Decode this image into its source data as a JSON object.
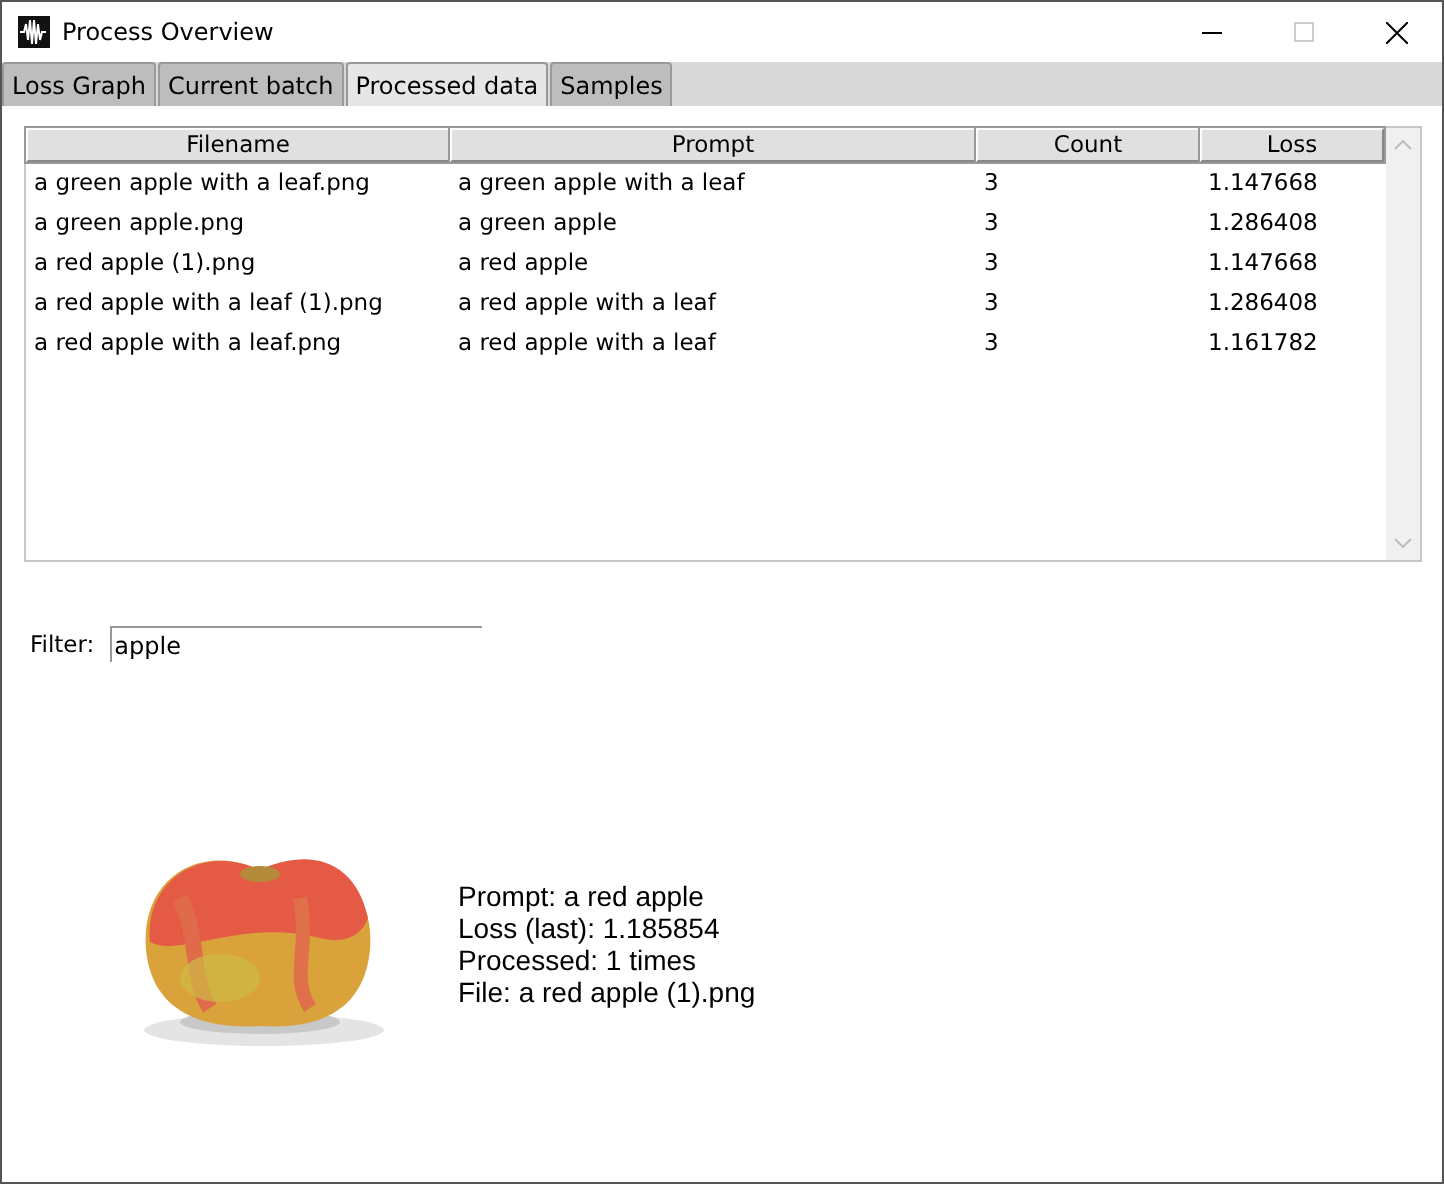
{
  "window": {
    "title": "Process Overview"
  },
  "tabs": [
    {
      "label": "Loss Graph",
      "selected": false
    },
    {
      "label": "Current batch",
      "selected": false
    },
    {
      "label": "Processed data",
      "selected": true
    },
    {
      "label": "Samples",
      "selected": false
    }
  ],
  "table": {
    "columns": [
      "Filename",
      "Prompt",
      "Count",
      "Loss"
    ],
    "rows": [
      [
        "a green apple with a leaf.png",
        "a green apple with a leaf",
        "3",
        "1.147668"
      ],
      [
        "a green apple.png",
        "a green apple",
        "3",
        "1.286408"
      ],
      [
        "a red apple (1).png",
        "a red apple",
        "3",
        "1.147668"
      ],
      [
        "a red apple with a leaf (1).png",
        "a red apple with a leaf",
        "3",
        "1.286408"
      ],
      [
        "a red apple with a leaf.png",
        "a red apple with a leaf",
        "3",
        "1.161782"
      ]
    ]
  },
  "filter": {
    "label": "Filter:",
    "value": "apple"
  },
  "preview": {
    "kind": "picture"
  },
  "details": [
    "Prompt: a red apple",
    "Loss (last): 1.185854",
    "Processed: 1 times",
    "File: a red apple (1).png"
  ]
}
